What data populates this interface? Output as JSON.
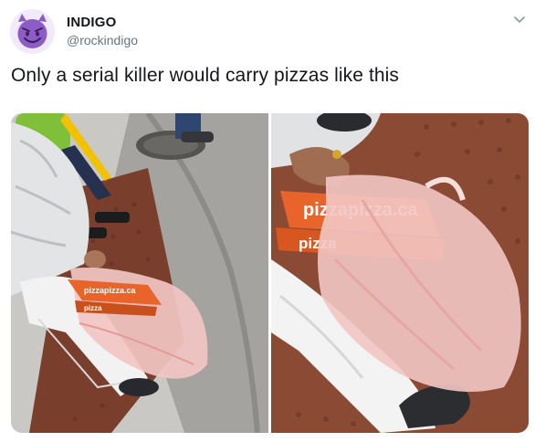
{
  "tweet": {
    "author": {
      "name": "INDIGO",
      "handle": "@rockindigo",
      "avatar_icon": "smiling-imp-emoji",
      "avatar_color": "#8e5cc7"
    },
    "text": "Only a serial killer would carry pizzas like this",
    "menu_icon": "chevron-down-icon",
    "photos": [
      {
        "box_text_top": "pizzapizza.ca",
        "box_text_bottom": "pizza"
      },
      {
        "box_text_top": "pizzapizza.ca",
        "box_text_bottom": "pizza"
      }
    ]
  },
  "colors": {
    "text_primary": "#14171a",
    "text_secondary": "#657786",
    "pizza_box": "#e8642b",
    "bag": "#f2c6c3"
  }
}
